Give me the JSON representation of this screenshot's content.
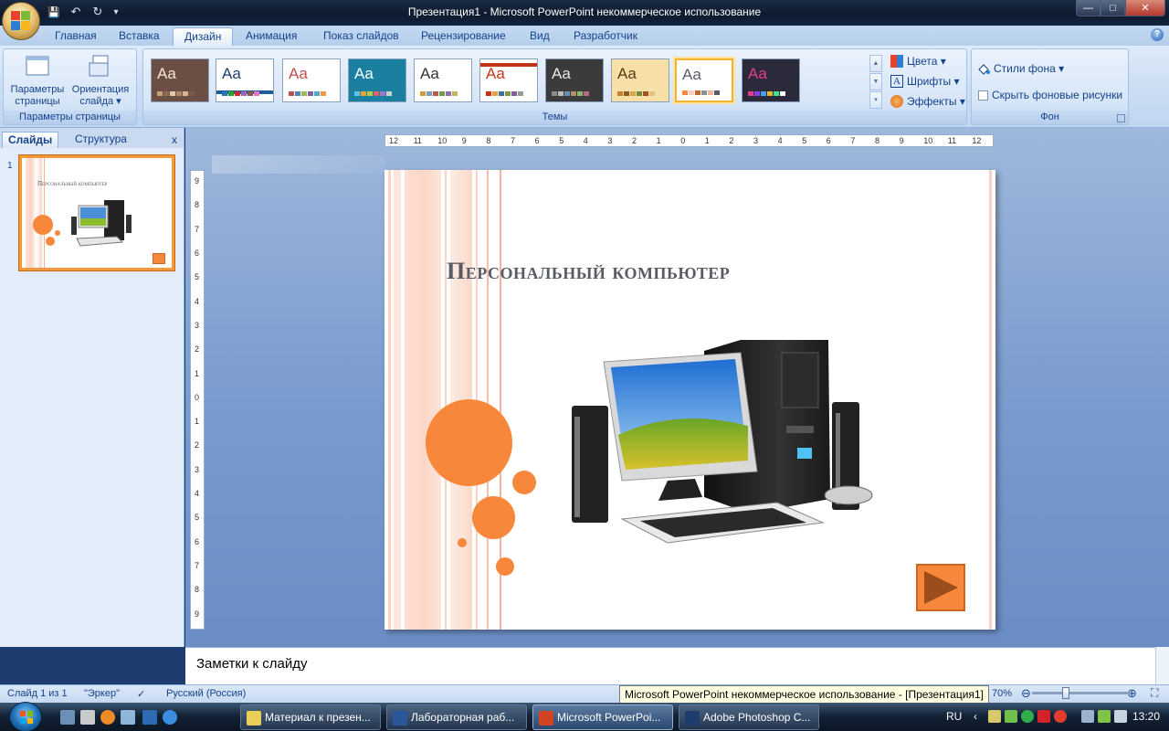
{
  "window": {
    "title": "Презентация1 - Microsoft PowerPoint некоммерческое использование",
    "controls": {
      "minimize": "—",
      "maximize": "□",
      "close": "✕"
    }
  },
  "qat": {
    "save": "💾",
    "undo": "↶",
    "redo": "↻",
    "customize": "▾"
  },
  "ribbon_tabs": [
    "Главная",
    "Вставка",
    "Дизайн",
    "Анимация",
    "Показ слайдов",
    "Рецензирование",
    "Вид",
    "Разработчик"
  ],
  "active_tab": "Дизайн",
  "help": "?",
  "groups": {
    "page_setup": {
      "label": "Параметры страницы",
      "page_params": "Параметры\nстраницы",
      "orientation": "Ориентация\nслайда ▾"
    },
    "themes": {
      "label": "Темы",
      "theme_sample": "Aa",
      "colors": "Цвета ▾",
      "fonts": "Шрифты ▾",
      "effects": "Эффекты ▾"
    },
    "background": {
      "label": "Фон",
      "styles": "Стили фона ▾",
      "hide_graphics": "Скрыть фоновые рисунки"
    }
  },
  "left_pane": {
    "tabs": [
      "Слайды",
      "Структура"
    ],
    "close": "x",
    "slide_number": "1",
    "thumb_title": "Персональный компьютер"
  },
  "ruler": {
    "h_labels": [
      "12",
      "11",
      "10",
      "9",
      "8",
      "7",
      "6",
      "5",
      "4",
      "3",
      "2",
      "1",
      "0",
      "1",
      "2",
      "3",
      "4",
      "5",
      "6",
      "7",
      "8",
      "9",
      "10",
      "11",
      "12"
    ],
    "v_labels": [
      "9",
      "8",
      "7",
      "6",
      "5",
      "4",
      "3",
      "2",
      "1",
      "0",
      "1",
      "2",
      "3",
      "4",
      "5",
      "6",
      "7",
      "8",
      "9"
    ]
  },
  "slide": {
    "title": "Персональный компьютер",
    "accent": "#f7873b"
  },
  "notes": {
    "placeholder": "Заметки к слайду"
  },
  "status": {
    "slide": "Слайд 1 из 1",
    "theme": "\"Эркер\"",
    "language": "Русский (Россия)",
    "zoom": "70%",
    "tooltip": "Microsoft PowerPoint некоммерческое использование - [Презентация1]"
  },
  "taskbar": {
    "tasks": [
      "Материал к презен...",
      "Лабораторная раб...",
      "Microsoft PowerPoi...",
      "Adobe Photoshop C..."
    ],
    "language": "RU",
    "clock": "13:20"
  }
}
